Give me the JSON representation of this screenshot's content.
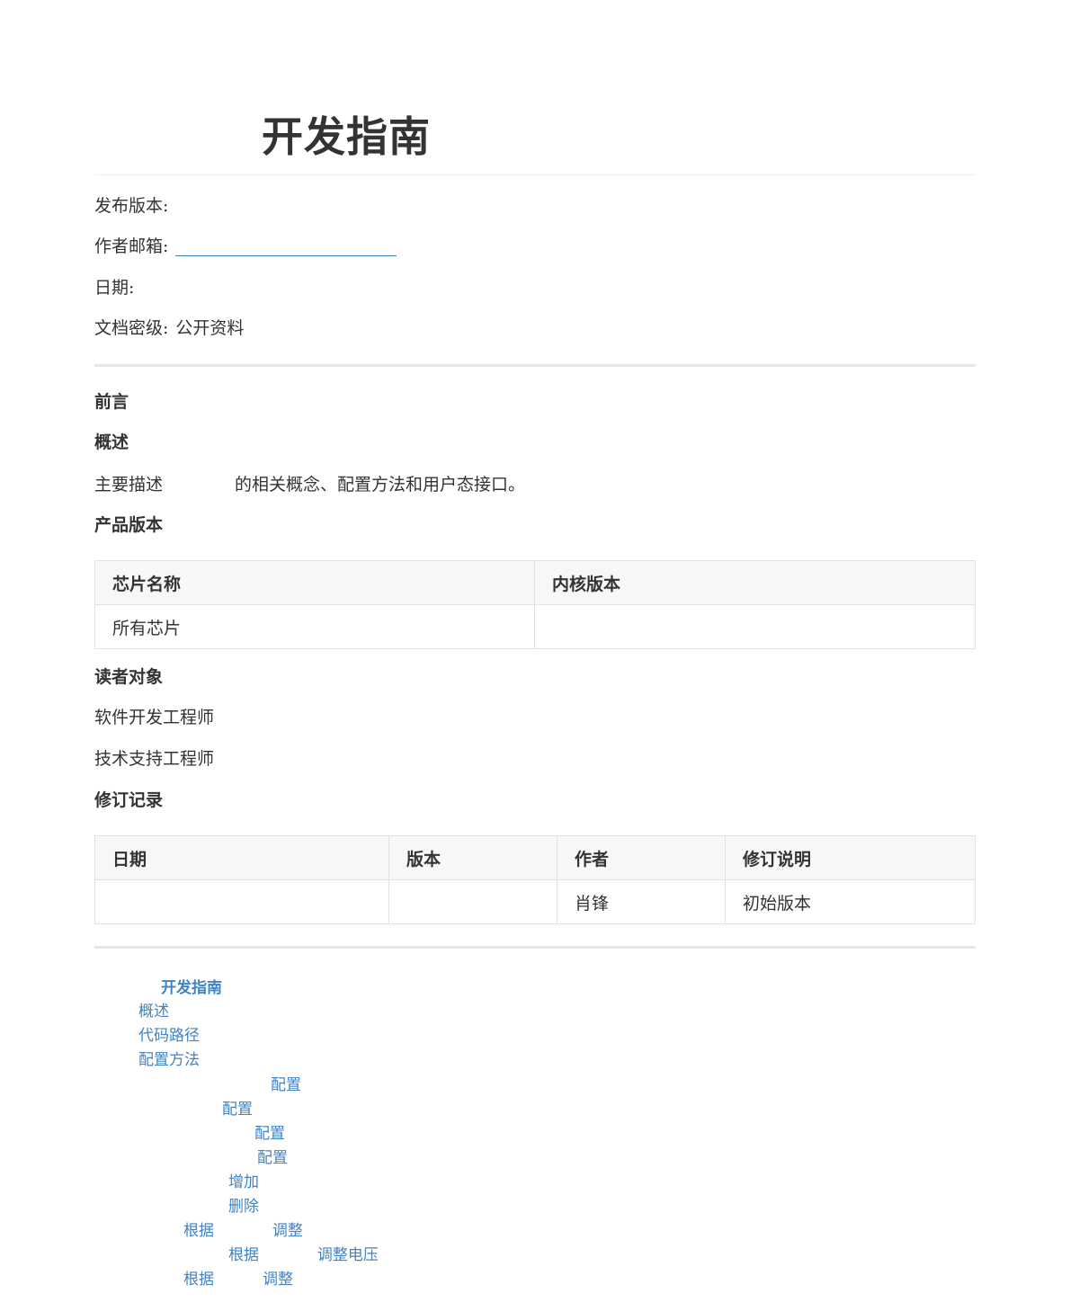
{
  "document": {
    "title": "开发指南",
    "meta": {
      "release_version_label": "发布版本:",
      "release_version_value": "",
      "author_email_label": "作者邮箱:",
      "date_label": "日期:",
      "date_value": "",
      "classification_label": "文档密级:",
      "classification_value": "公开资料"
    },
    "preface": {
      "heading": "前言",
      "overview_heading": "概述",
      "overview_text_a": "主要描述",
      "overview_text_b": "的相关概念、配置方法和用户态接口。",
      "product_version_heading": "产品版本",
      "product_table": {
        "headers": [
          "芯片名称",
          "内核版本"
        ],
        "rows": [
          [
            "所有芯片",
            ""
          ]
        ]
      },
      "audience_heading": "读者对象",
      "audience": [
        "软件开发工程师",
        "技术支持工程师"
      ],
      "revision_heading": "修订记录",
      "revision_table": {
        "headers": [
          "日期",
          "版本",
          "作者",
          "修订说明"
        ],
        "rows": [
          [
            "",
            "",
            "肖锋",
            "初始版本"
          ]
        ]
      }
    },
    "toc": [
      {
        "text": "开发指南"
      },
      {
        "text": "概述"
      },
      {
        "text": "代码路径"
      },
      {
        "text": "配置方法"
      },
      {
        "text": "配置"
      },
      {
        "text": "配置"
      },
      {
        "text": "配置"
      },
      {
        "text": "配置"
      },
      {
        "text": "增加"
      },
      {
        "text": "删除"
      },
      {
        "text": "根据            调整"
      },
      {
        "text": "根据            调整电压"
      },
      {
        "text": "根据          调整"
      }
    ]
  }
}
